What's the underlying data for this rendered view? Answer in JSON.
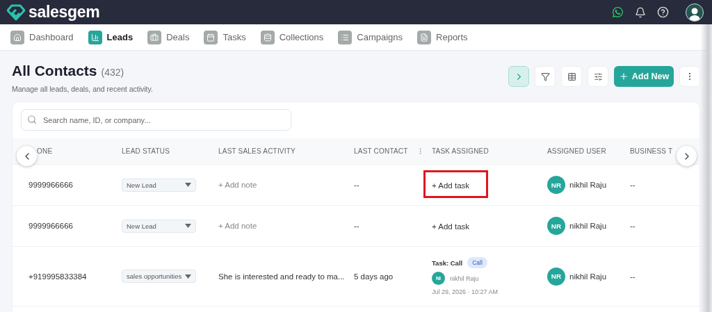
{
  "brand": "salesgem",
  "nav": [
    {
      "label": "Dashboard",
      "selected": false
    },
    {
      "label": "Leads",
      "selected": true
    },
    {
      "label": "Deals",
      "selected": false
    },
    {
      "label": "Tasks",
      "selected": false
    },
    {
      "label": "Collections",
      "selected": false
    },
    {
      "label": "Campaigns",
      "selected": false
    },
    {
      "label": "Reports",
      "selected": false
    }
  ],
  "page": {
    "title": "All Contacts",
    "count": "(432)",
    "subtitle": "Manage all leads, deals, and recent activity."
  },
  "toolbar": {
    "expand_selected": true,
    "add_label": "Add New"
  },
  "search": {
    "placeholder": "Search name, ID, or company..."
  },
  "table": {
    "columns": [
      "ONE",
      "LEAD STATUS",
      "LAST SALES ACTIVITY",
      "LAST CONTACT",
      "TASK ASSIGNED",
      "ASSIGNED USER",
      "BUSINESS T"
    ],
    "rows": [
      {
        "phone": "9999966666",
        "status": "New Lead",
        "activity": {
          "kind": "add",
          "text": "+ Add note"
        },
        "last_contact": "--",
        "task": {
          "kind": "add",
          "label": "+ Add task",
          "highlighted": true
        },
        "user_initials": "NR",
        "user": "nikhil Raju",
        "business": "--"
      },
      {
        "phone": "9999966666",
        "status": "New Lead",
        "activity": {
          "kind": "add",
          "text": "+ Add note"
        },
        "last_contact": "--",
        "task": {
          "kind": "add",
          "label": "+ Add task",
          "highlighted": false
        },
        "user_initials": "NR",
        "user": "nikhil Raju",
        "business": "--"
      },
      {
        "phone": "+919995833384",
        "status": "sales opportunities",
        "activity": {
          "kind": "note",
          "text": "She is interested and ready to ma..."
        },
        "last_contact": "5 days ago",
        "task": {
          "kind": "task",
          "title": "Task: Call",
          "badge": "Call",
          "assignee_initials": "NI",
          "assignee": "nikhil Raju",
          "due": "Jul 29, 2026 · 10:27 AM"
        },
        "user_initials": "NR",
        "user": "nikhil Raju",
        "business": "--"
      }
    ]
  }
}
